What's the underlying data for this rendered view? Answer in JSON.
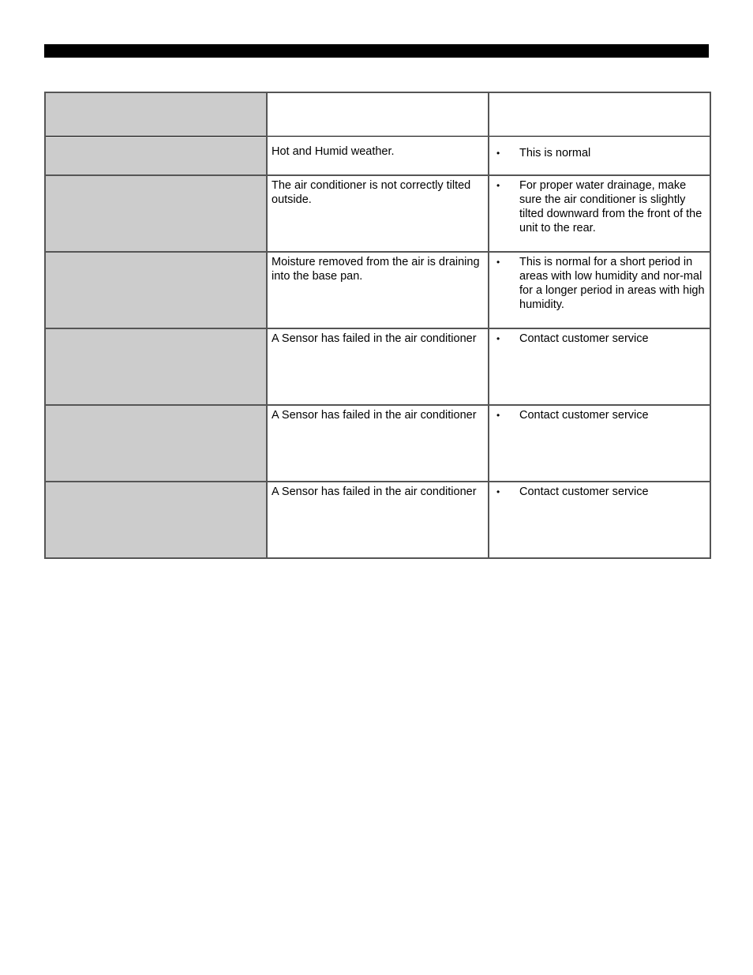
{
  "page": {
    "header_bar_color": "#000000"
  },
  "table": {
    "header": {
      "problem": "",
      "cause": "",
      "solution": ""
    },
    "rows": [
      {
        "problem": "",
        "cause": "Hot and Humid weather.",
        "solutions": [
          "This is normal"
        ]
      },
      {
        "problem": "",
        "cause": "The air conditioner is not correctly tilted outside.",
        "solutions": [
          "For proper water drainage, make sure the air conditioner is slightly tilted downward from the front of the unit to the rear."
        ]
      },
      {
        "problem": "",
        "cause": "Moisture removed from the air is draining into the base pan.",
        "solutions": [
          "This is normal for a short period in areas with low humidity and nor-mal for a longer period in areas with high humidity."
        ]
      },
      {
        "problem": "",
        "cause": "A Sensor has failed in the air conditioner",
        "solutions": [
          "Contact customer service"
        ]
      },
      {
        "problem": "",
        "cause": "A Sensor has failed in the air conditioner",
        "solutions": [
          "Contact customer service"
        ]
      },
      {
        "problem": "",
        "cause": "A Sensor has failed in the air conditioner",
        "solutions": [
          "Contact customer service"
        ]
      }
    ],
    "bullet_glyph": "•",
    "colors": {
      "problem_column_bg": "#cccccc",
      "border": "#555555"
    }
  }
}
